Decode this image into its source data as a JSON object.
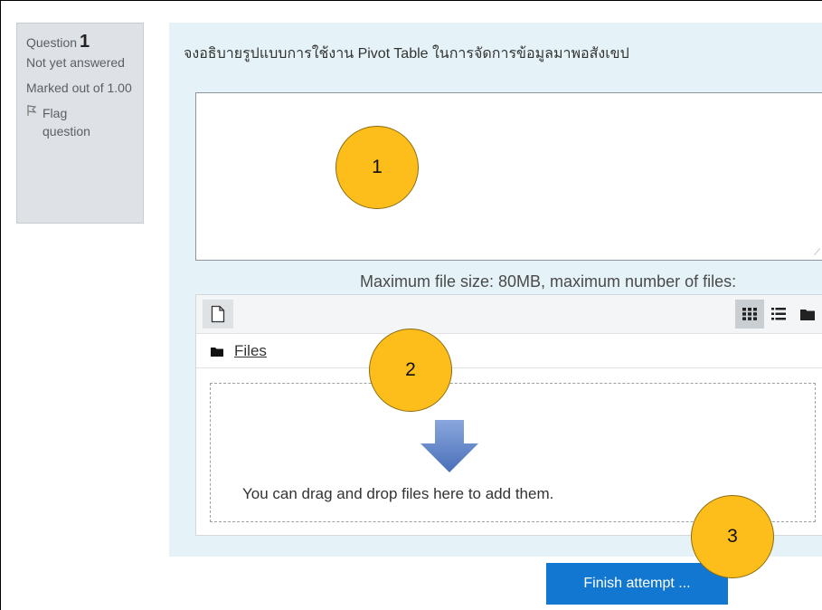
{
  "question_info": {
    "label": "Question",
    "number": "1",
    "state": "Not yet answered",
    "grade": "Marked out of 1.00",
    "flag_label": "Flag question"
  },
  "question": {
    "text": "จงอธิบายรูปแบบการใช้งาน Pivot Table ในการจัดการข้อมูลมาพอสังเขป",
    "answer_value": ""
  },
  "filemanager": {
    "limits_text": "Maximum file size: 80MB, maximum number of files:",
    "path_label": "Files",
    "dropzone_text": "You can drag and drop files here to add them."
  },
  "finish_button_label": "Finish attempt ...",
  "markers": [
    "1",
    "2",
    "3"
  ],
  "colors": {
    "panel_bg": "#e5f2f7",
    "info_bg": "#dee2e6",
    "primary": "#1177d1",
    "marker": "#fdbd1a",
    "arrow": "#5b7fc4"
  },
  "icons": [
    "add-file-icon",
    "grid-view-icon",
    "list-view-icon",
    "folder-view-icon",
    "folder-icon",
    "drop-arrow-icon",
    "flag-icon"
  ]
}
